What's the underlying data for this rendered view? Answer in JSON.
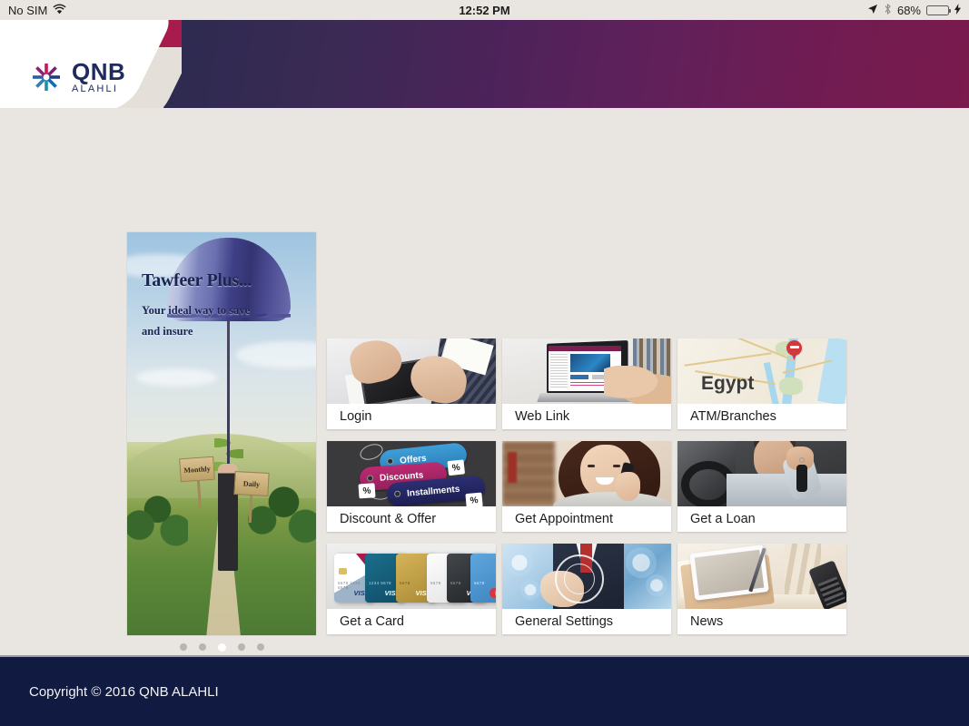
{
  "statusbar": {
    "carrier": "No SIM",
    "wifi_icon": "wifi-icon",
    "time": "12:52 PM",
    "location_icon": "location-arrow-icon",
    "bluetooth_icon": "bluetooth-icon",
    "battery_percent": "68%",
    "battery_level": 68,
    "charging_icon": "lightning-bolt-icon",
    "battery_color": "#33cc33"
  },
  "header": {
    "logo_brand": "QNB",
    "logo_sub": "ALAHLI",
    "gradient_start": "#2b2a4f",
    "gradient_end": "#7a1a4d",
    "accent_magenta": "#a81c4d"
  },
  "banner": {
    "title": "Tawfeer Plus...",
    "subtitle_line1": "Your ideal way to save",
    "subtitle_line2": "and insure",
    "sign_left": "Monthly",
    "sign_right": "Daily",
    "dots_total": 5,
    "dots_active_index": 2
  },
  "tiles": [
    {
      "id": "login",
      "label": "Login",
      "art": "art-login"
    },
    {
      "id": "web-link",
      "label": "Web Link",
      "art": "art-web"
    },
    {
      "id": "atm-branches",
      "label": "ATM/Branches",
      "art": "art-map",
      "map_label": "Egypt"
    },
    {
      "id": "discount",
      "label": "Discount & Offer",
      "art": "art-disc",
      "tags": [
        "Offers",
        "Discounts",
        "Installments"
      ],
      "pct": "%"
    },
    {
      "id": "appointment",
      "label": "Get Appointment",
      "art": "art-appt"
    },
    {
      "id": "loan",
      "label": "Get a Loan",
      "art": "art-loan"
    },
    {
      "id": "card",
      "label": "Get a Card",
      "art": "art-card",
      "brands": [
        "VISA",
        "VISA",
        "VISA",
        "VISA",
        "mastercard"
      ]
    },
    {
      "id": "settings",
      "label": "General Settings",
      "art": "art-set"
    },
    {
      "id": "news",
      "label": "News",
      "art": "art-news"
    }
  ],
  "footer": {
    "copyright": "Copyright © 2016 QNB ALAHLI"
  }
}
